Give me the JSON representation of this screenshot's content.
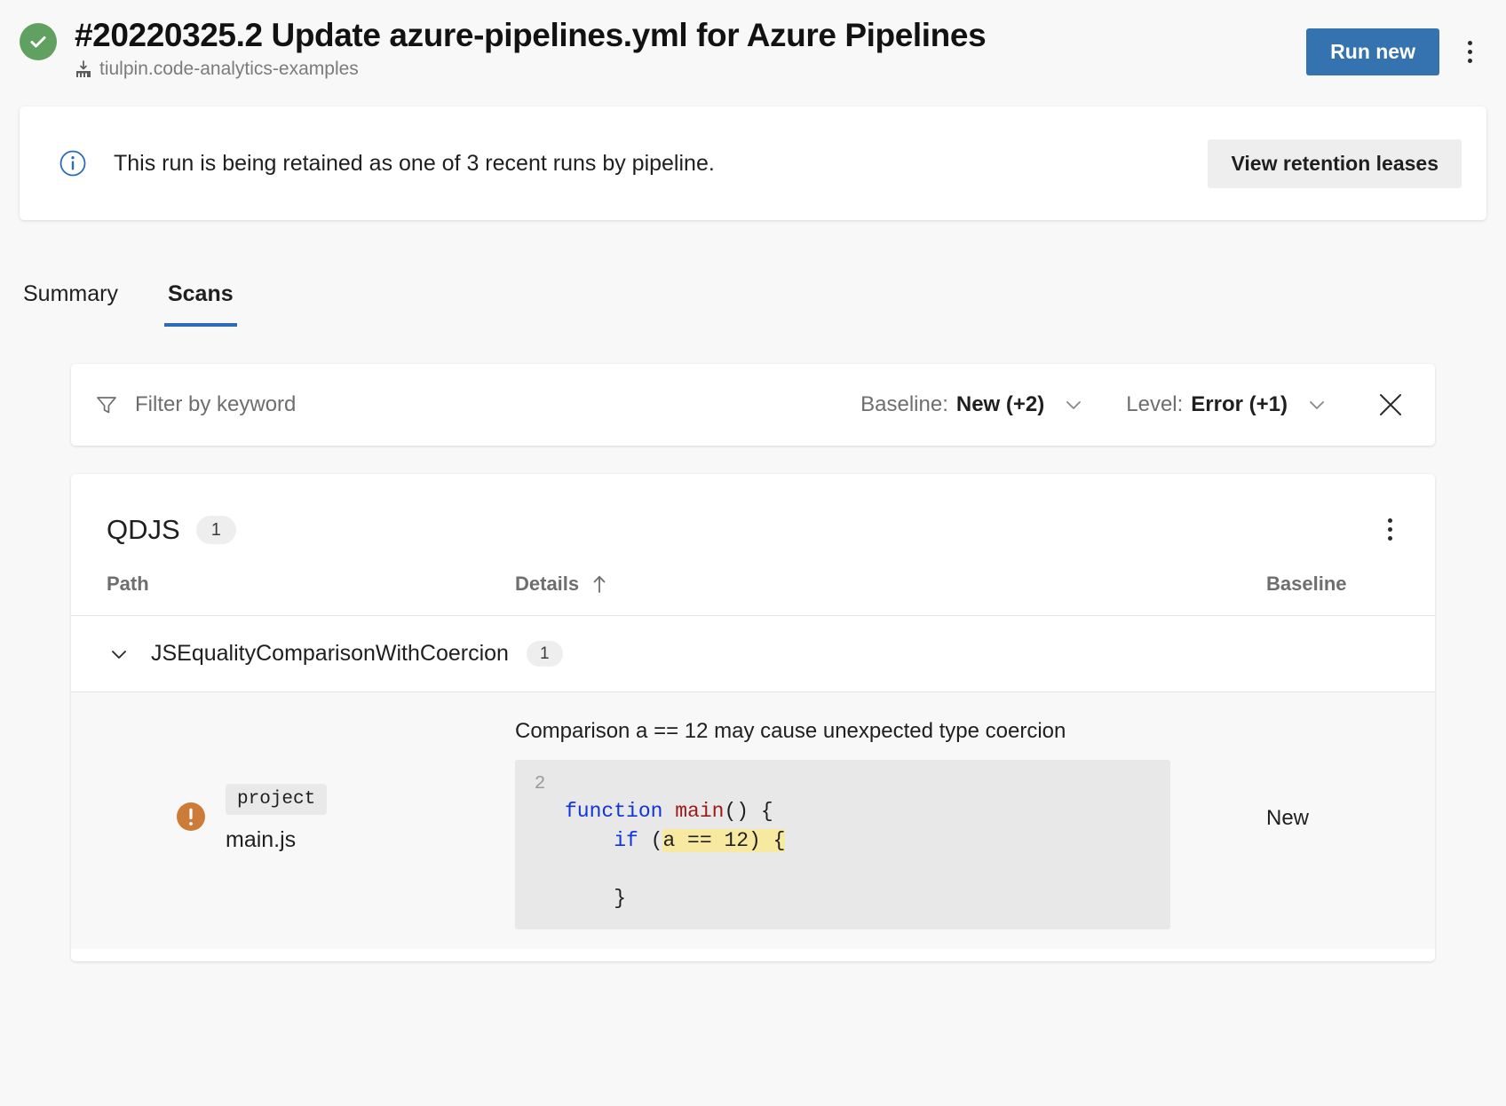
{
  "header": {
    "status_icon": "check-circle-icon",
    "status_color": "#60a060",
    "title": "#20220325.2 Update azure-pipelines.yml for Azure Pipelines",
    "repo_icon": "pipeline-repo-icon",
    "repo": "tiulpin.code-analytics-examples",
    "run_new_label": "Run new",
    "run_new_color": "#3572b0",
    "more_menu_icon": "kebab-menu-icon"
  },
  "banner": {
    "icon": "info-circle-icon",
    "icon_color": "#2b6cb8",
    "text": "This run is being retained as one of 3 recent runs by pipeline.",
    "action_label": "View retention leases"
  },
  "tabs": [
    {
      "label": "Summary",
      "active": false
    },
    {
      "label": "Scans",
      "active": true
    }
  ],
  "filter": {
    "funnel_icon": "funnel-icon",
    "placeholder": "Filter by keyword",
    "pills": [
      {
        "label": "Baseline:",
        "value": "New (+2)",
        "chevron_icon": "chevron-down-icon"
      },
      {
        "label": "Level:",
        "value": "Error (+1)",
        "chevron_icon": "chevron-down-icon"
      }
    ],
    "close_icon": "close-icon"
  },
  "results": {
    "tool_name": "QDJS",
    "tool_count": "1",
    "more_menu_icon": "kebab-menu-icon",
    "columns": {
      "path": "Path",
      "details": "Details",
      "details_sort_icon": "sort-ascending-arrow-icon",
      "baseline": "Baseline"
    },
    "group": {
      "chevron_icon": "chevron-down-icon",
      "label": "JSEqualityComparisonWithCoercion",
      "count": "1"
    },
    "issue": {
      "severity_icon": "error-exclamation-icon",
      "severity_color": "#cd7b39",
      "scope_tag": "project",
      "file": "main.js",
      "message": "Comparison a == 12 may cause unexpected type coercion",
      "code": {
        "line_number": "2",
        "line1_kw": "function",
        "line1_fn": "main",
        "line1_rest": "() {",
        "line2_kw": "if",
        "line2_pre": " (",
        "line2_hl": "a == 12) {",
        "line4": "    }"
      },
      "baseline": "New"
    }
  }
}
